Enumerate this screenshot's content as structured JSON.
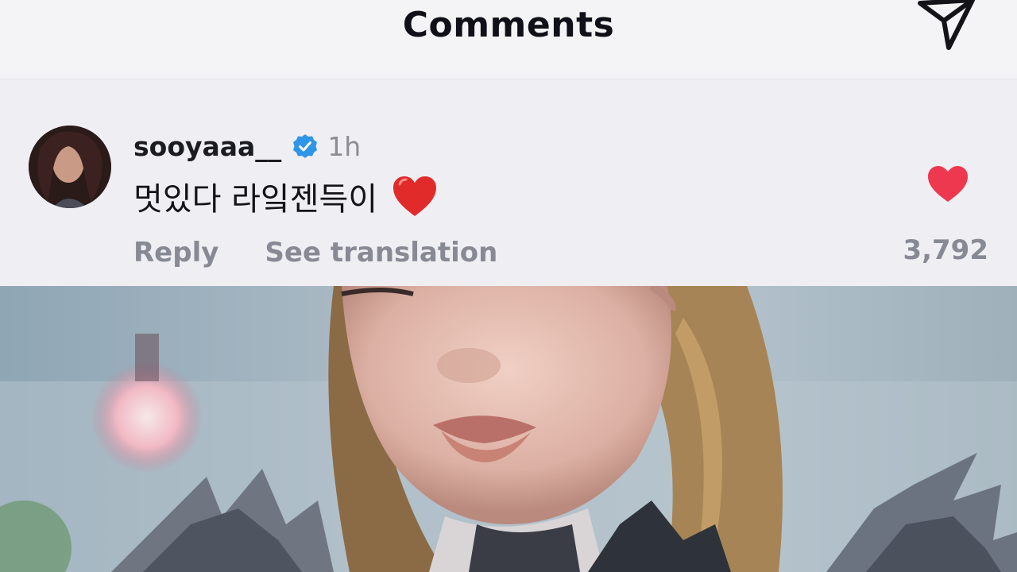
{
  "header": {
    "title": "Comments",
    "share_icon": "paper-plane-icon"
  },
  "comment": {
    "username": "sooyaaa__",
    "verified_icon": "verified-badge-icon",
    "time": "1h",
    "text": "멋있다 라잌젠득이",
    "emoji_icon": "red-heart-emoji-icon",
    "reply_label": "Reply",
    "translate_label": "See translation",
    "like_icon": "heart-icon",
    "like_count": "3,792",
    "like_color": "#ed3850"
  },
  "photo": {
    "description_icon": "post-photo"
  }
}
